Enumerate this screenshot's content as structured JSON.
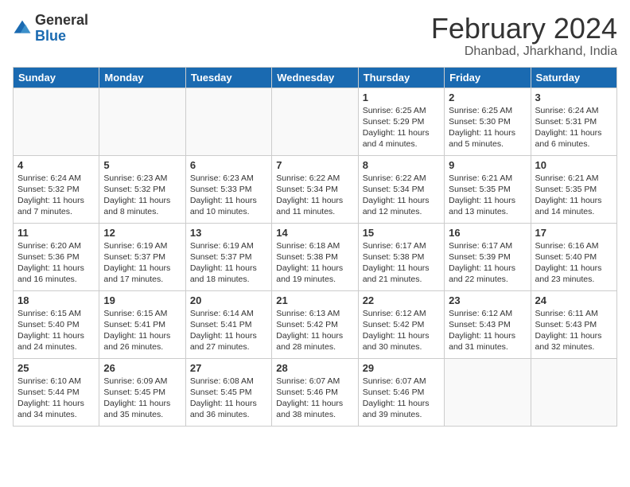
{
  "header": {
    "logo_general": "General",
    "logo_blue": "Blue",
    "title": "February 2024",
    "subtitle": "Dhanbad, Jharkhand, India"
  },
  "calendar": {
    "days_of_week": [
      "Sunday",
      "Monday",
      "Tuesday",
      "Wednesday",
      "Thursday",
      "Friday",
      "Saturday"
    ],
    "weeks": [
      [
        {
          "day": "",
          "info": ""
        },
        {
          "day": "",
          "info": ""
        },
        {
          "day": "",
          "info": ""
        },
        {
          "day": "",
          "info": ""
        },
        {
          "day": "1",
          "info": "Sunrise: 6:25 AM\nSunset: 5:29 PM\nDaylight: 11 hours and 4 minutes."
        },
        {
          "day": "2",
          "info": "Sunrise: 6:25 AM\nSunset: 5:30 PM\nDaylight: 11 hours and 5 minutes."
        },
        {
          "day": "3",
          "info": "Sunrise: 6:24 AM\nSunset: 5:31 PM\nDaylight: 11 hours and 6 minutes."
        }
      ],
      [
        {
          "day": "4",
          "info": "Sunrise: 6:24 AM\nSunset: 5:32 PM\nDaylight: 11 hours and 7 minutes."
        },
        {
          "day": "5",
          "info": "Sunrise: 6:23 AM\nSunset: 5:32 PM\nDaylight: 11 hours and 8 minutes."
        },
        {
          "day": "6",
          "info": "Sunrise: 6:23 AM\nSunset: 5:33 PM\nDaylight: 11 hours and 10 minutes."
        },
        {
          "day": "7",
          "info": "Sunrise: 6:22 AM\nSunset: 5:34 PM\nDaylight: 11 hours and 11 minutes."
        },
        {
          "day": "8",
          "info": "Sunrise: 6:22 AM\nSunset: 5:34 PM\nDaylight: 11 hours and 12 minutes."
        },
        {
          "day": "9",
          "info": "Sunrise: 6:21 AM\nSunset: 5:35 PM\nDaylight: 11 hours and 13 minutes."
        },
        {
          "day": "10",
          "info": "Sunrise: 6:21 AM\nSunset: 5:35 PM\nDaylight: 11 hours and 14 minutes."
        }
      ],
      [
        {
          "day": "11",
          "info": "Sunrise: 6:20 AM\nSunset: 5:36 PM\nDaylight: 11 hours and 16 minutes."
        },
        {
          "day": "12",
          "info": "Sunrise: 6:19 AM\nSunset: 5:37 PM\nDaylight: 11 hours and 17 minutes."
        },
        {
          "day": "13",
          "info": "Sunrise: 6:19 AM\nSunset: 5:37 PM\nDaylight: 11 hours and 18 minutes."
        },
        {
          "day": "14",
          "info": "Sunrise: 6:18 AM\nSunset: 5:38 PM\nDaylight: 11 hours and 19 minutes."
        },
        {
          "day": "15",
          "info": "Sunrise: 6:17 AM\nSunset: 5:38 PM\nDaylight: 11 hours and 21 minutes."
        },
        {
          "day": "16",
          "info": "Sunrise: 6:17 AM\nSunset: 5:39 PM\nDaylight: 11 hours and 22 minutes."
        },
        {
          "day": "17",
          "info": "Sunrise: 6:16 AM\nSunset: 5:40 PM\nDaylight: 11 hours and 23 minutes."
        }
      ],
      [
        {
          "day": "18",
          "info": "Sunrise: 6:15 AM\nSunset: 5:40 PM\nDaylight: 11 hours and 24 minutes."
        },
        {
          "day": "19",
          "info": "Sunrise: 6:15 AM\nSunset: 5:41 PM\nDaylight: 11 hours and 26 minutes."
        },
        {
          "day": "20",
          "info": "Sunrise: 6:14 AM\nSunset: 5:41 PM\nDaylight: 11 hours and 27 minutes."
        },
        {
          "day": "21",
          "info": "Sunrise: 6:13 AM\nSunset: 5:42 PM\nDaylight: 11 hours and 28 minutes."
        },
        {
          "day": "22",
          "info": "Sunrise: 6:12 AM\nSunset: 5:42 PM\nDaylight: 11 hours and 30 minutes."
        },
        {
          "day": "23",
          "info": "Sunrise: 6:12 AM\nSunset: 5:43 PM\nDaylight: 11 hours and 31 minutes."
        },
        {
          "day": "24",
          "info": "Sunrise: 6:11 AM\nSunset: 5:43 PM\nDaylight: 11 hours and 32 minutes."
        }
      ],
      [
        {
          "day": "25",
          "info": "Sunrise: 6:10 AM\nSunset: 5:44 PM\nDaylight: 11 hours and 34 minutes."
        },
        {
          "day": "26",
          "info": "Sunrise: 6:09 AM\nSunset: 5:45 PM\nDaylight: 11 hours and 35 minutes."
        },
        {
          "day": "27",
          "info": "Sunrise: 6:08 AM\nSunset: 5:45 PM\nDaylight: 11 hours and 36 minutes."
        },
        {
          "day": "28",
          "info": "Sunrise: 6:07 AM\nSunset: 5:46 PM\nDaylight: 11 hours and 38 minutes."
        },
        {
          "day": "29",
          "info": "Sunrise: 6:07 AM\nSunset: 5:46 PM\nDaylight: 11 hours and 39 minutes."
        },
        {
          "day": "",
          "info": ""
        },
        {
          "day": "",
          "info": ""
        }
      ]
    ]
  }
}
